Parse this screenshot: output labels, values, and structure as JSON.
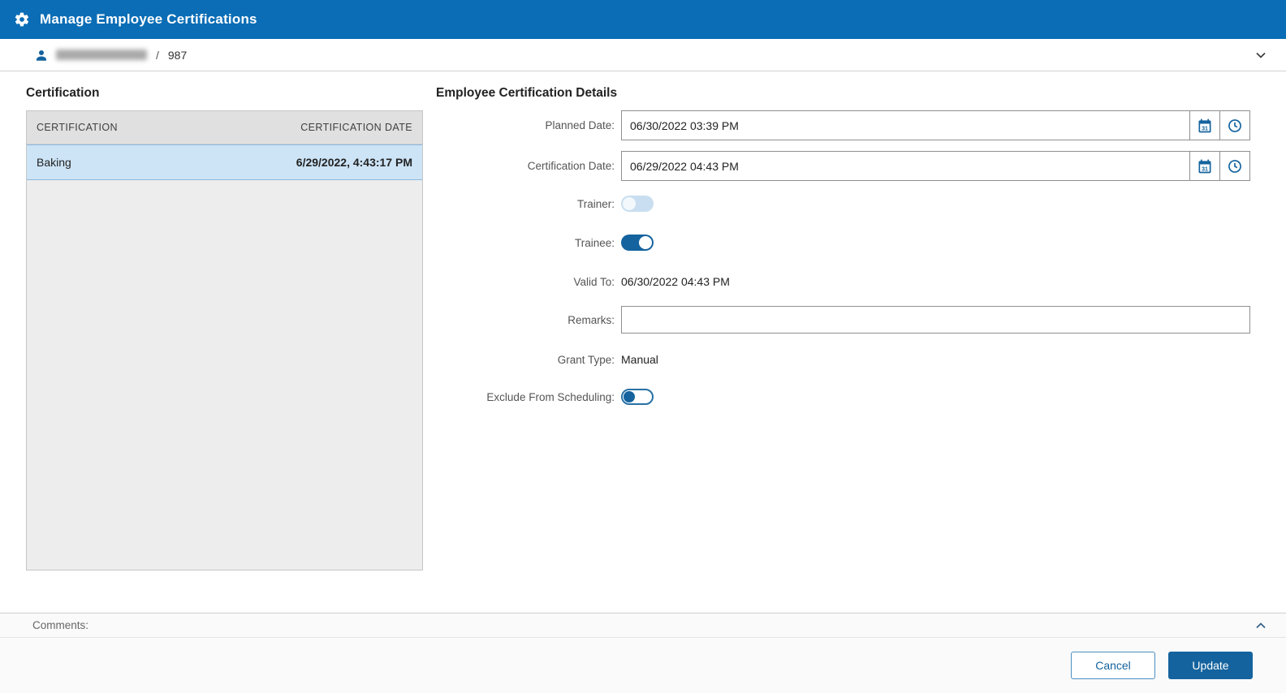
{
  "header": {
    "title": "Manage Employee Certifications"
  },
  "breadcrumb": {
    "separator": "/",
    "employee_id": "987"
  },
  "certification_panel": {
    "title": "Certification",
    "columns": [
      "CERTIFICATION",
      "CERTIFICATION DATE"
    ],
    "rows": [
      {
        "certification": "Baking",
        "certification_date": "6/29/2022, 4:43:17 PM",
        "selected": true
      }
    ]
  },
  "details_panel": {
    "title": "Employee Certification Details",
    "planned_date": {
      "label": "Planned Date:",
      "value": "06/30/2022 03:39 PM"
    },
    "certification_date": {
      "label": "Certification Date:",
      "value": "06/29/2022 04:43 PM"
    },
    "trainer": {
      "label": "Trainer:",
      "value": false
    },
    "trainee": {
      "label": "Trainee:",
      "value": true
    },
    "valid_to": {
      "label": "Valid To:",
      "value": "06/30/2022 04:43 PM"
    },
    "remarks": {
      "label": "Remarks:",
      "value": ""
    },
    "grant_type": {
      "label": "Grant Type:",
      "value": "Manual"
    },
    "exclude_from_scheduling": {
      "label": "Exclude From Scheduling:",
      "value": false
    }
  },
  "comments": {
    "label": "Comments:"
  },
  "footer": {
    "cancel_label": "Cancel",
    "update_label": "Update"
  },
  "colors": {
    "titlebar_blue": "#0a6db6",
    "accent_blue": "#14639e",
    "selected_row_bg": "#cde4f6"
  }
}
